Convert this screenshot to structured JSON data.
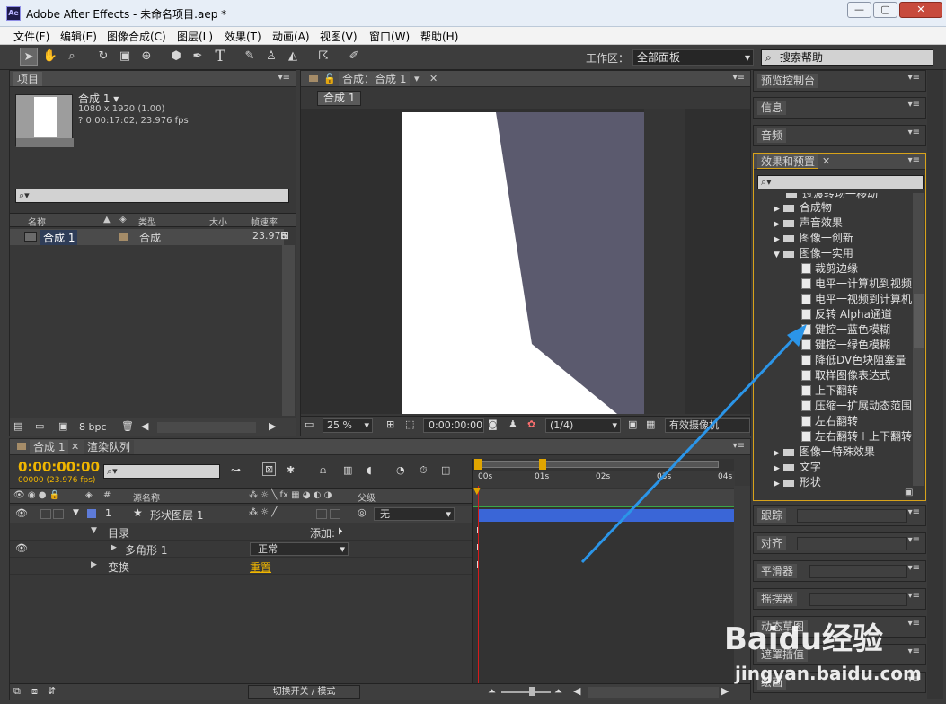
{
  "window": {
    "title": "Adobe After Effects - 未命名项目.aep *",
    "logo": "Ae",
    "min_icon": "minimize-icon",
    "max_icon": "restore-icon",
    "close_icon": "close-icon"
  },
  "menu": [
    "文件(F)",
    "编辑(E)",
    "图像合成(C)",
    "图层(L)",
    "效果(T)",
    "动画(A)",
    "视图(V)",
    "窗口(W)",
    "帮助(H)"
  ],
  "toolbar": {
    "workspace_label": "工作区：",
    "workspace_value": "全部面板",
    "search_help": "搜索帮助",
    "tools": [
      "selection-icon",
      "hand-icon",
      "zoom-icon",
      "rotate-icon",
      "camera-icon",
      "pan-behind-icon",
      "shape-icon",
      "pen-icon",
      "text-icon",
      "brush-icon",
      "clone-stamp-icon",
      "eraser-icon",
      "puppet-icon",
      "pin-icon"
    ]
  },
  "project": {
    "tab": "项目",
    "comp_name": "合成 1 ▾",
    "comp_size": "1080 x 1920 (1.00)",
    "comp_duration": "? 0:00:17:02, 23.976 fps",
    "col_name": "名称",
    "col_type": "类型",
    "col_size": "大小",
    "col_rate": "帧速率",
    "item": {
      "name": "合成 1",
      "type": "合成",
      "rate": "23.976"
    },
    "bpc": "8 bpc"
  },
  "comp_viewer": {
    "tab": "合成：合成 1",
    "sub_tab": "合成 1",
    "zoom": "25 %",
    "timecode": "0:00:00:00",
    "resolution": "(1/4)",
    "camera": "有效摄像机"
  },
  "right_panels": {
    "preview": "预览控制台",
    "info": "信息",
    "audio": "音频",
    "effects": "效果和预置",
    "tracker": "跟踪",
    "align": "对齐",
    "smoother": "平滑器",
    "wiggler": "摇摆器",
    "motion_sketch": "动态草图",
    "mask_interp": "遮罩插值",
    "paint": "绘画"
  },
  "effects_tree": {
    "top_cut": "过渡转场一移动",
    "folders_top": [
      "合成物",
      "声音效果",
      "图像一创新",
      "图像一实用"
    ],
    "items": [
      "裁剪边缘",
      "电平一计算机到视频",
      "电平一视频到计算机",
      "反转 Alpha通道",
      "键控一蓝色模糊",
      "键控一绿色模糊",
      "降低DV色块阻塞量",
      "取样图像表达式",
      "上下翻转",
      "压缩一扩展动态范围",
      "左右翻转",
      "左右翻转＋上下翻转"
    ],
    "folders_bottom": [
      "图像一特殊效果",
      "文字",
      "形状"
    ]
  },
  "timeline": {
    "tab": "合成 1",
    "render_tab": "渲染队列",
    "timecode": "0:00:00:00",
    "fps_line": "00000 (23.976 fps)",
    "col_source": "源名称",
    "col_parent": "父级",
    "layer_num": "1",
    "layer_name": "形状图层 1",
    "parent_value": "无",
    "contents": "目录",
    "add": "添加:",
    "polygon": "多角形 1",
    "blend": "正常",
    "transform": "变换",
    "reset": "重置",
    "ticks": [
      "00s",
      "01s",
      "02s",
      "03s",
      "04s"
    ],
    "toggle_label": "切换开关 / 模式"
  },
  "colors": {
    "panel": "#383838",
    "accent": "#f0b600",
    "layer_bar": "#3a66d7",
    "playhead": "#d71a1a",
    "annotation_arrow": "#2b95e8"
  },
  "watermark": {
    "brand": "Baidu经验",
    "url": "jingyan.baidu.com"
  }
}
